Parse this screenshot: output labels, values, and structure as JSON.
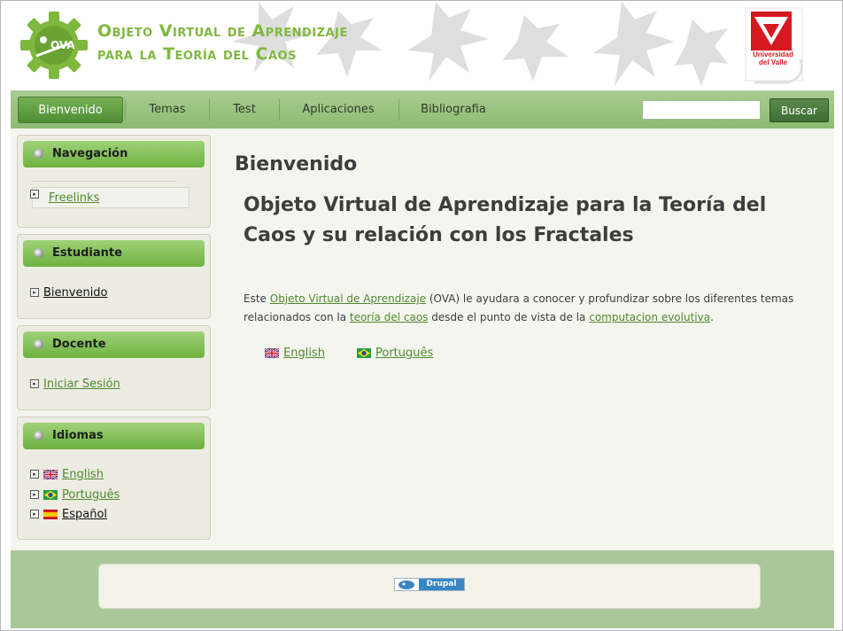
{
  "header": {
    "site_name_line1": "Objeto Virtual de Aprendizaje",
    "site_name_line2": "para la Teoría del Caos",
    "logo_text": "OVA",
    "university_line1": "Universidad",
    "university_line2": "del Valle"
  },
  "nav": {
    "items": [
      {
        "label": "Bienvenido"
      },
      {
        "label": "Temas"
      },
      {
        "label": "Test"
      },
      {
        "label": "Aplicaciones"
      },
      {
        "label": "Bibliografia"
      }
    ],
    "search_value": "",
    "search_button": "Buscar"
  },
  "sidebar": {
    "navegacion": {
      "title": "Navegación",
      "links": [
        "Freelinks"
      ]
    },
    "estudiante": {
      "title": "Estudiante",
      "links": [
        "Bienvenido"
      ]
    },
    "docente": {
      "title": "Docente",
      "links": [
        "Iniciar Sesión"
      ]
    },
    "idiomas": {
      "title": "Idiomas",
      "links": [
        "English",
        "Português",
        "Español"
      ]
    }
  },
  "content": {
    "page_title": "Bienvenido",
    "heading": "Objeto Virtual de Aprendizaje para la Teoría del Caos y su relación con los Fractales",
    "text_1": "Este ",
    "link_ova": "Objeto Virtual de Aprendizaje",
    "text_2": " (OVA) le ayudara a conocer y profundizar sobre los diferentes temas relacionados con la ",
    "link_caos": "teoría del caos",
    "text_3": " desde el punto de vista de la ",
    "link_computacion": "computacion evolutiva",
    "text_4": ".",
    "lang_english": "English",
    "lang_portugues": "Português"
  },
  "footer": {
    "badge_text": "Drupal"
  },
  "icons": {
    "flags": [
      "uk-flag-icon",
      "brazil-flag-icon",
      "spain-flag-icon"
    ],
    "bullet": "menu-arrow-icon",
    "block_dot": "grey-dot-icon"
  },
  "colors": {
    "accent_green": "#7fb83e",
    "link_green": "#4e8a2f",
    "nav_bg": "#9dc584",
    "footer_bg": "#a9c89a",
    "university_red": "#d71920"
  }
}
